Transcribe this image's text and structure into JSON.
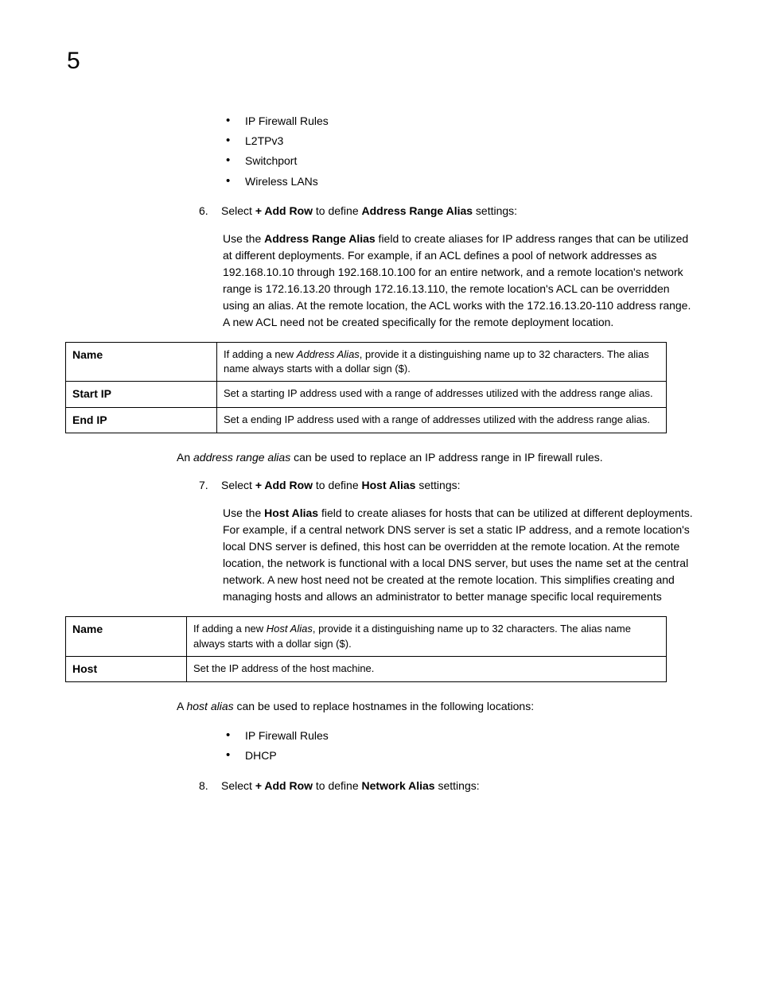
{
  "chapter": "5",
  "bullets1": [
    "IP Firewall Rules",
    "L2TPv3",
    "Switchport",
    "Wireless LANs"
  ],
  "step6": {
    "num": "6.",
    "prefix": "Select ",
    "bold1": "+ Add Row",
    "mid1": " to define ",
    "bold2": "Address Range Alias",
    "suffix": " settings:"
  },
  "para6": {
    "p1": "Use the ",
    "b1": "Address Range Alias",
    "p2": " field to create aliases for IP address ranges that can be utilized at different deployments. For example, if an ACL defines a pool of network addresses as 192.168.10.10 through 192.168.10.100 for an entire network, and a remote location's network range is 172.16.13.20 through 172.16.13.110, the remote location's ACL can be overridden using an alias. At the remote location, the ACL works with the 172.16.13.20-110 address range. A new ACL need not be created specifically for the remote deployment location."
  },
  "table1": [
    {
      "label": "Name",
      "d1": "If adding a new ",
      "i1": "Address Alias",
      "d2": ", provide it a distinguishing name up to 32 characters. The alias name always starts with a dollar sign ($)."
    },
    {
      "label": "Start IP",
      "d1": "Set a starting IP address used with a range of addresses utilized with the address range alias.",
      "i1": "",
      "d2": ""
    },
    {
      "label": "End IP",
      "d1": "Set a ending IP address used with a range of addresses utilized with the address range alias.",
      "i1": "",
      "d2": ""
    }
  ],
  "paraAfter1": {
    "p1": "An ",
    "i1": "address range alias",
    "p2": " can be used to replace an IP address range in IP firewall rules."
  },
  "step7": {
    "num": "7.",
    "prefix": "Select ",
    "bold1": "+ Add Row",
    "mid1": " to define ",
    "bold2": "Host Alias",
    "suffix": " settings:"
  },
  "para7": {
    "p1": "Use the ",
    "b1": "Host Alias",
    "p2": " field to create aliases for hosts that can be utilized at different deployments. For example, if a central network DNS server is set a static IP address, and a remote location's local DNS server is defined, this host can be overridden at the remote location. At the remote location, the network is functional with a local DNS server, but uses the name set at the central network. A new host need not be created at the remote location. This simplifies creating and managing hosts and allows an administrator to better manage specific local requirements"
  },
  "table2": [
    {
      "label": "Name",
      "d1": "If adding a new ",
      "i1": "Host Alias",
      "d2": ", provide it a distinguishing name up to 32 characters. The alias name always starts with a dollar sign ($)."
    },
    {
      "label": "Host",
      "d1": "Set the IP address of the host machine.",
      "i1": "",
      "d2": ""
    }
  ],
  "paraAfter2": {
    "p1": "A ",
    "i1": "host alias",
    "p2": " can be used to replace hostnames in the following locations:"
  },
  "bullets2": [
    "IP Firewall Rules",
    "DHCP"
  ],
  "step8": {
    "num": "8.",
    "prefix": "Select ",
    "bold1": "+ Add Row",
    "mid1": " to define ",
    "bold2": "Network Alias",
    "suffix": " settings:"
  }
}
